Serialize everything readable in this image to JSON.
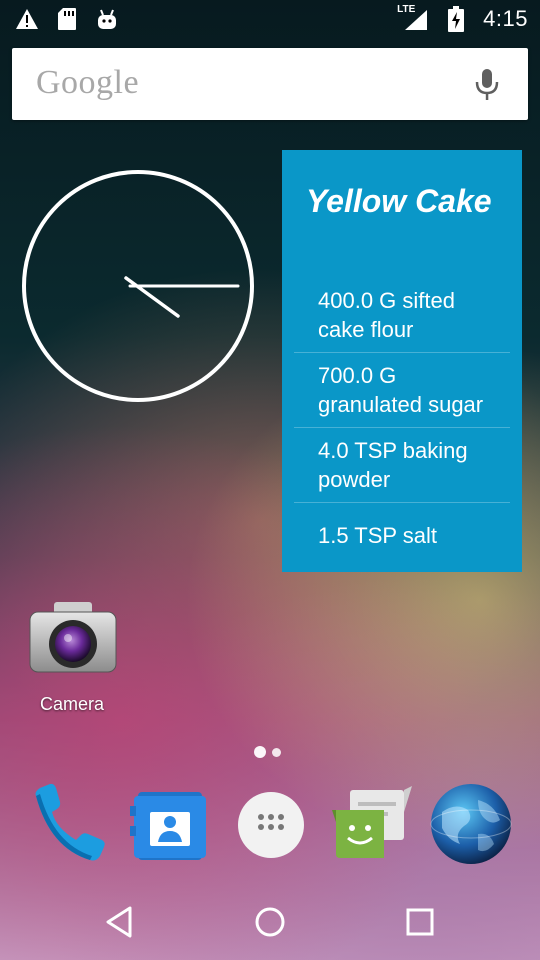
{
  "status_bar": {
    "time": "4:15",
    "network": "LTE",
    "left_icons": [
      "warning-icon",
      "sd-card-icon",
      "android-icon"
    ],
    "right_icons": [
      "signal-icon",
      "battery-charging-icon"
    ]
  },
  "search": {
    "logo": "Google",
    "mic_icon": "mic-icon"
  },
  "clock": {
    "type": "analog",
    "hour_hand_angle_deg": 120,
    "minute_hand_angle_deg": 90
  },
  "recipe_widget": {
    "title": "Yellow Cake",
    "ingredients": [
      "400.0 G sifted cake flour",
      "700.0 G granulated sugar",
      "4.0 TSP baking powder",
      "1.5 TSP salt"
    ],
    "background": "#0a97c8"
  },
  "home_apps": [
    {
      "label": "Camera",
      "icon": "camera-icon"
    }
  ],
  "page_indicator": {
    "pages": 2,
    "current": 1
  },
  "dock": [
    {
      "name": "phone",
      "icon": "phone-icon"
    },
    {
      "name": "contacts",
      "icon": "contacts-icon"
    },
    {
      "name": "app-drawer",
      "icon": "app-drawer-icon"
    },
    {
      "name": "messaging",
      "icon": "messaging-icon"
    },
    {
      "name": "browser",
      "icon": "browser-globe-icon"
    }
  ],
  "nav_bar": [
    "back-icon",
    "home-icon",
    "recents-icon"
  ]
}
